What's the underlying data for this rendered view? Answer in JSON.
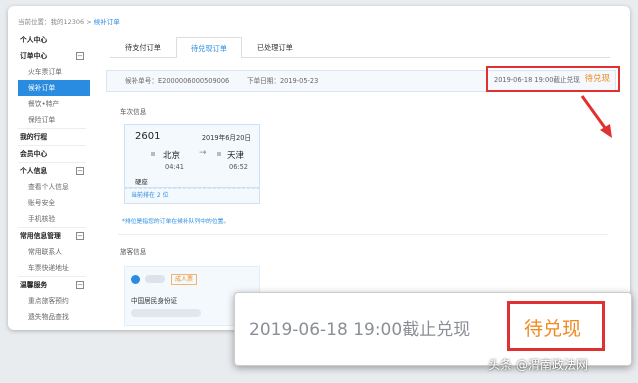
{
  "breadcrumb": {
    "prefix": "当前位置：我的12306 > ",
    "current": "候补订单"
  },
  "sidebar": {
    "items": [
      {
        "label": "个人中心",
        "kind": "group"
      },
      {
        "label": "订单中心",
        "kind": "group",
        "toggle": "−"
      },
      {
        "label": "火车票订单",
        "kind": "sub"
      },
      {
        "label": "候补订单",
        "kind": "active"
      },
      {
        "label": "餐饮•特产",
        "kind": "sub"
      },
      {
        "label": "保险订单",
        "kind": "sub"
      },
      {
        "label": "我的行程",
        "kind": "group"
      },
      {
        "label": "会员中心",
        "kind": "group"
      },
      {
        "label": "个人信息",
        "kind": "group",
        "toggle": "−"
      },
      {
        "label": "查看个人信息",
        "kind": "sub"
      },
      {
        "label": "账号安全",
        "kind": "sub"
      },
      {
        "label": "手机核验",
        "kind": "sub"
      },
      {
        "label": "常用信息管理",
        "kind": "group",
        "toggle": "−"
      },
      {
        "label": "常用联系人",
        "kind": "sub"
      },
      {
        "label": "车票快递地址",
        "kind": "sub"
      },
      {
        "label": "温馨服务",
        "kind": "group",
        "toggle": "−"
      },
      {
        "label": "重点旅客预约",
        "kind": "sub"
      },
      {
        "label": "遗失物品查找",
        "kind": "sub"
      }
    ]
  },
  "tabs": [
    {
      "label": "待支付订单",
      "active": false
    },
    {
      "label": "待兑现订单",
      "active": true
    },
    {
      "label": "已处理订单",
      "active": false
    }
  ],
  "order": {
    "sn_label": "候补单号：E2000006000509006",
    "date_label": "下单日期：2019-05-23",
    "deadline": "2019-06-18 19:00截止兑现",
    "status": "待兑现"
  },
  "sections": {
    "train_info": "车次信息",
    "passenger_info": "旅客信息"
  },
  "ticket": {
    "train": "2601",
    "date": "2019年6月20日",
    "from": "北京",
    "to": "天津",
    "arrow": "→",
    "depart_time": "04:41",
    "arrive_time": "06:52",
    "seat": "硬座",
    "queue": "当前排在 2 位"
  },
  "note": "*排位是指您的订单在候补队列中的位置。",
  "passenger": {
    "badge": "成人票",
    "id_type": "中国居民身份证"
  },
  "zoom": {
    "deadline": "2019-06-18 19:00截止兑现",
    "status": "待兑现"
  },
  "watermark": "头条 @渭南政法网",
  "colors": {
    "accent": "#2a8ce0",
    "highlight": "#e03030",
    "status": "#f08a20"
  }
}
